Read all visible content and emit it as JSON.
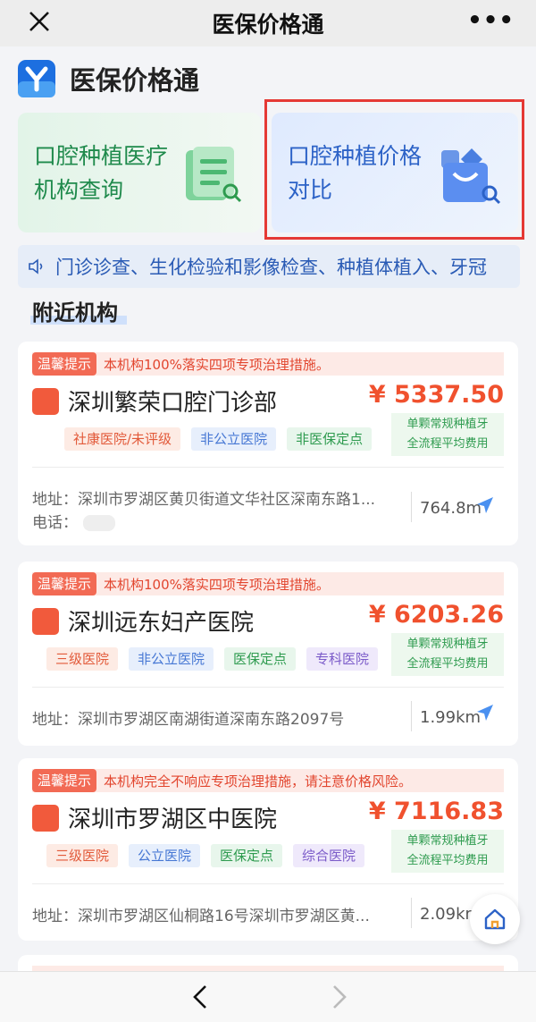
{
  "topbar": {
    "title": "医保价格通"
  },
  "brand": {
    "name": "医保价格通"
  },
  "cards": [
    {
      "label": "口腔种植医疗机构查询"
    },
    {
      "label": "口腔种植价格对比"
    }
  ],
  "notice": {
    "text": "门诊诊查、生化检验和影像检查、种植体植入、牙冠"
  },
  "section": {
    "title": "附近机构"
  },
  "institutions": [
    {
      "tip_badge": "温馨提示",
      "tip": "本机构100%落实四项专项治理措施。",
      "name": "深圳繁荣口腔门诊部",
      "price": "¥ 5337.50",
      "price_note_1": "单颗常规种植牙",
      "price_note_2": "全流程平均费用",
      "tags": [
        "社康医院/未评级",
        "非公立医院",
        "非医保定点"
      ],
      "address": "地址：深圳市罗湖区黄贝街道文华社区深南东路1...",
      "phone_label": "电话：",
      "distance": "764.8m"
    },
    {
      "tip_badge": "温馨提示",
      "tip": "本机构100%落实四项专项治理措施。",
      "name": "深圳远东妇产医院",
      "price": "¥ 6203.26",
      "price_note_1": "单颗常规种植牙",
      "price_note_2": "全流程平均费用",
      "tags": [
        "三级医院",
        "非公立医院",
        "医保定点",
        "专科医院"
      ],
      "address": "地址：深圳市罗湖区南湖街道深南东路2097号",
      "distance": "1.99km"
    },
    {
      "tip_badge": "温馨提示",
      "tip": "本机构完全不响应专项治理措施，请注意价格风险。",
      "name": "深圳市罗湖区中医院",
      "price": "¥ 7116.83",
      "price_note_1": "单颗常规种植牙",
      "price_note_2": "全流程平均费用",
      "tags": [
        "三级医院",
        "公立医院",
        "医保定点",
        "综合医院"
      ],
      "address": "地址：深圳市罗湖区仙桐路16号深圳市罗湖区黄...",
      "distance": "2.09km"
    }
  ],
  "colors": {
    "accent_red": "#f0512e",
    "highlight": "#e53935",
    "blue": "#2c62c7",
    "green": "#1f8a4c"
  }
}
